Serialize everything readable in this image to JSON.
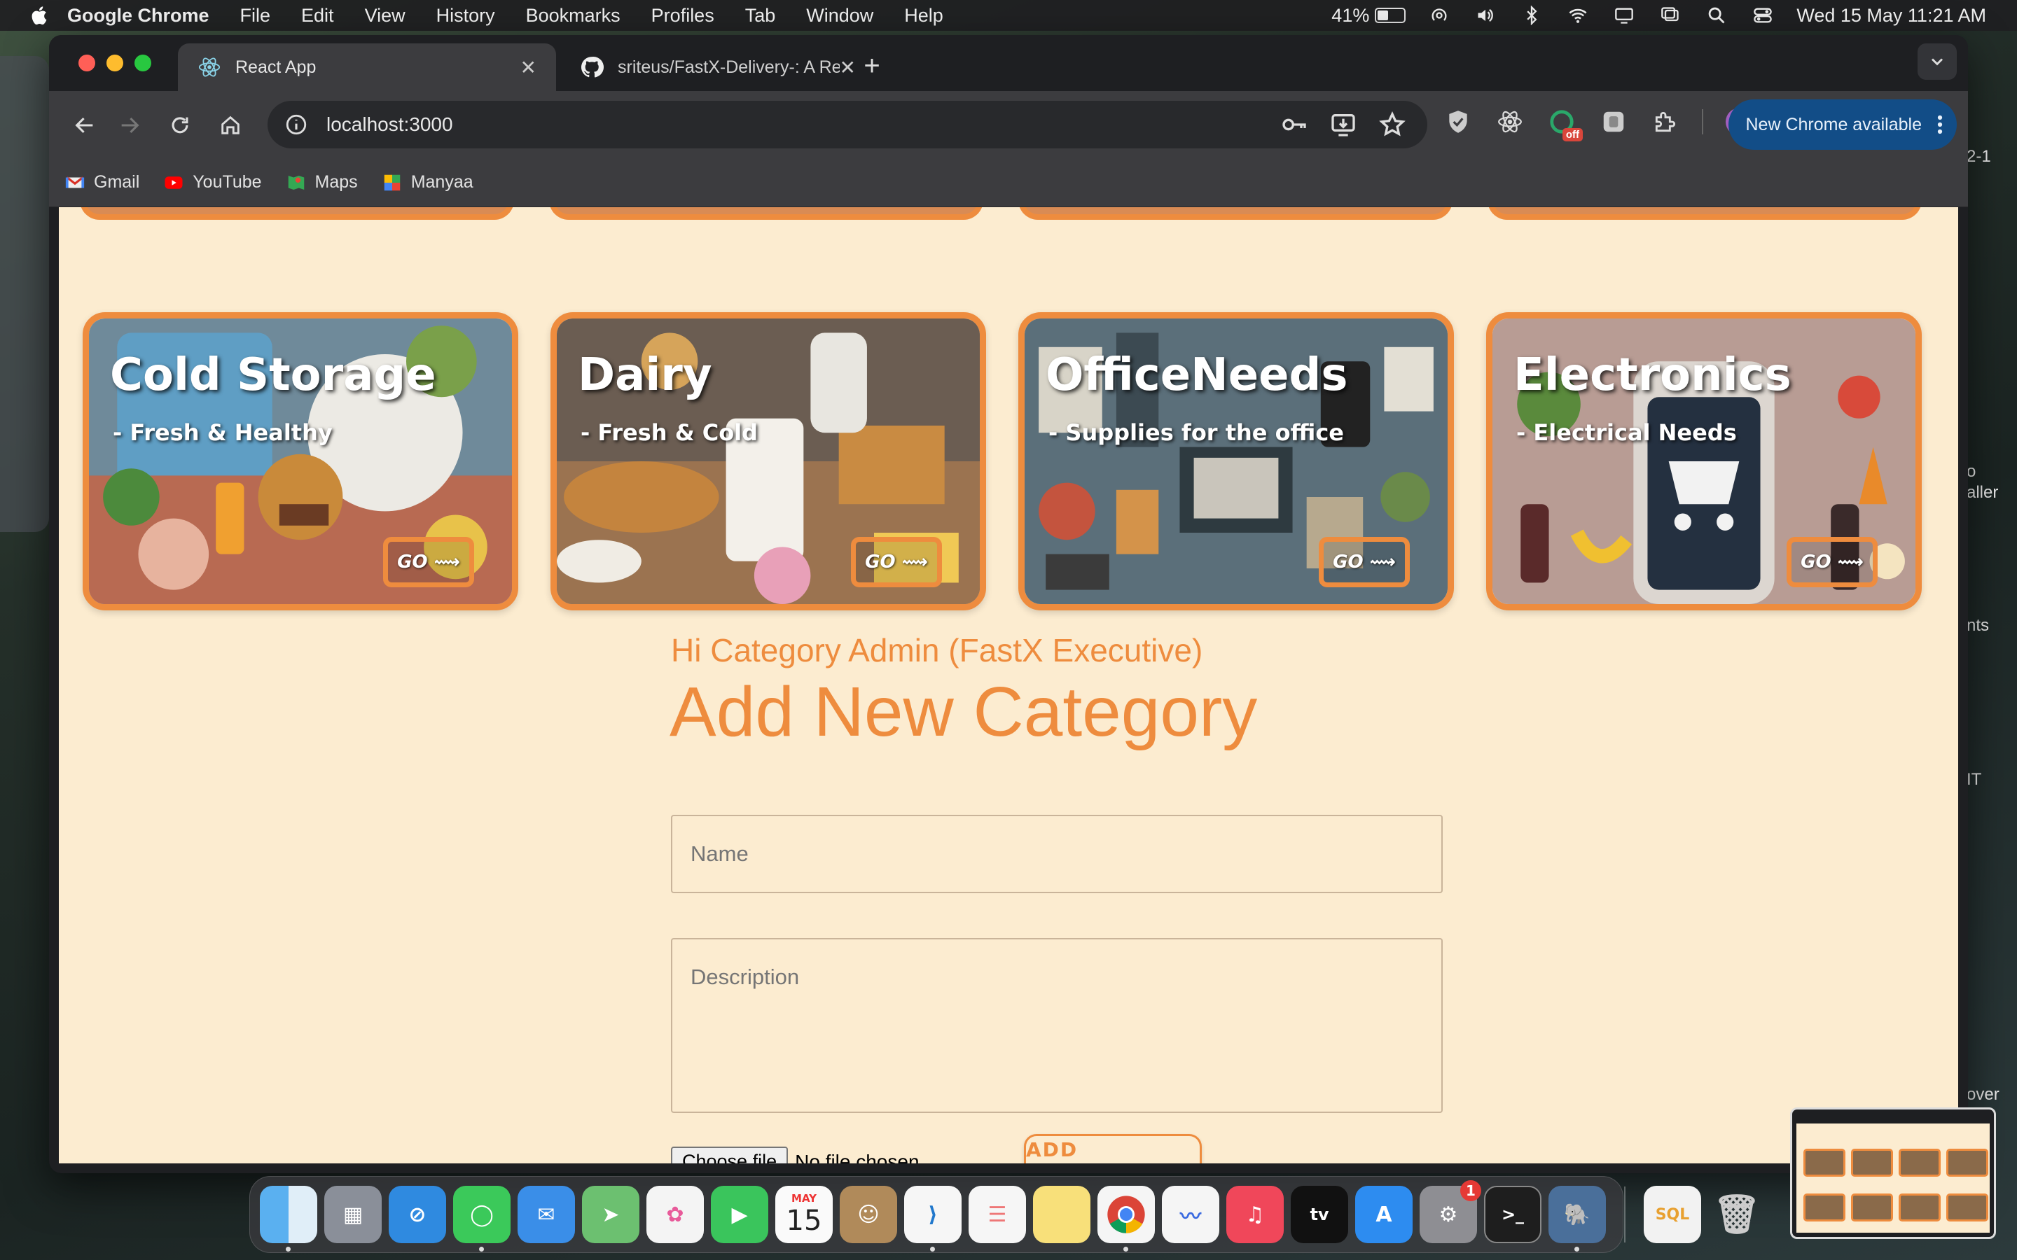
{
  "menubar": {
    "app_name": "Google Chrome",
    "items": [
      "File",
      "Edit",
      "View",
      "History",
      "Bookmarks",
      "Profiles",
      "Tab",
      "Window",
      "Help"
    ],
    "battery": "41%",
    "datetime": "Wed 15 May  11:21 AM"
  },
  "browser": {
    "tabs": [
      {
        "title": "React App",
        "icon": "react-icon"
      },
      {
        "title": "sriteus/FastX-Delivery-: A Re",
        "icon": "github-icon"
      }
    ],
    "url": "localhost:3000",
    "new_chrome_label": "New Chrome available",
    "ext_off_badge": "off",
    "bookmarks": [
      {
        "label": "Gmail",
        "icon": "gmail-icon"
      },
      {
        "label": "YouTube",
        "icon": "youtube-icon"
      },
      {
        "label": "Maps",
        "icon": "maps-icon"
      },
      {
        "label": "Manyaa",
        "icon": "manyaa-icon"
      }
    ]
  },
  "page": {
    "categories": [
      {
        "title": "Cold Storage",
        "subtitle": "- Fresh & Healthy",
        "go_label": "GO ⟿"
      },
      {
        "title": "Dairy",
        "subtitle": "- Fresh & Cold",
        "go_label": "GO ⟿"
      },
      {
        "title": "OfficeNeeds",
        "subtitle": "- Supplies for the office",
        "go_label": "GO ⟿"
      },
      {
        "title": "Electronics",
        "subtitle": "- Electrical Needs",
        "go_label": "GO ⟿"
      }
    ],
    "greeting": "Hi Category Admin (FastX Executive)",
    "form_title": "Add New Category",
    "name_placeholder": "Name",
    "description_placeholder": "Description",
    "file_button": "Choose file",
    "file_status": "No file chosen",
    "submit_label": "ADD CATEGORY"
  },
  "background_peek": [
    "2-1",
    "o",
    "aller",
    "nts",
    "IT",
    "over"
  ],
  "dock": {
    "calendar_month": "MAY",
    "calendar_day": "15",
    "settings_badge": "1",
    "apps": [
      "finder-icon",
      "launchpad-icon",
      "safari-icon",
      "messages-icon",
      "mail-icon",
      "maps-icon",
      "photos-icon",
      "facetime-icon",
      "calendar-icon",
      "contacts-icon",
      "vscode-icon",
      "reminders-icon",
      "notes-icon",
      "chrome-icon",
      "freeform-icon",
      "music-icon",
      "appletv-icon",
      "appstore-icon",
      "settings-icon",
      "terminal-icon",
      "postgres-icon",
      "sql-file-icon",
      "trash-icon"
    ]
  },
  "colors": {
    "accent": "#ee8c3e",
    "page_bg": "#fcecd0",
    "chrome_dark": "#3c3c3f"
  }
}
